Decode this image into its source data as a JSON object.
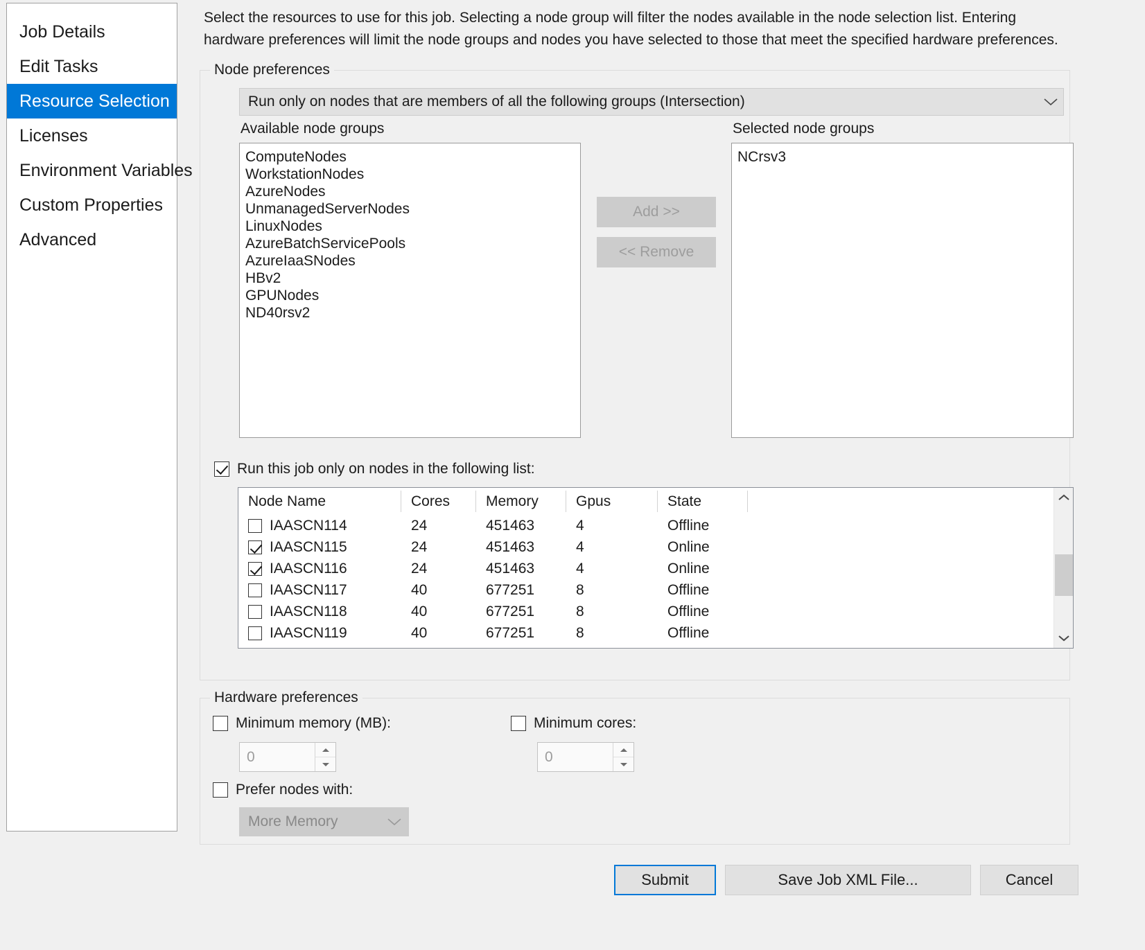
{
  "sidebar": {
    "items": [
      {
        "label": "Job Details",
        "active": false
      },
      {
        "label": "Edit Tasks",
        "active": false
      },
      {
        "label": "Resource Selection",
        "active": true
      },
      {
        "label": "Licenses",
        "active": false
      },
      {
        "label": "Environment Variables",
        "active": false
      },
      {
        "label": "Custom Properties",
        "active": false
      },
      {
        "label": "Advanced",
        "active": false
      }
    ]
  },
  "main": {
    "intro": "Select the resources to use for this job. Selecting a node group will filter the nodes available in the node selection list. Entering hardware preferences will limit the node groups and nodes you have selected to those that meet the specified hardware preferences."
  },
  "node_preferences": {
    "title": "Node preferences",
    "scope_combo": {
      "selected": "Run only on nodes that are members of all the following groups (Intersection)",
      "icon": "chevron-down-icon"
    },
    "available_label": "Available node groups",
    "selected_label": "Selected node groups",
    "available_groups": [
      "ComputeNodes",
      "WorkstationNodes",
      "AzureNodes",
      "UnmanagedServerNodes",
      "LinuxNodes",
      "AzureBatchServicePools",
      "AzureIaaSNodes",
      "HBv2",
      "GPUNodes",
      "ND40rsv2"
    ],
    "selected_groups": [
      "NCrsv3"
    ],
    "add_button": "Add >>",
    "remove_button": "<< Remove",
    "run_only_checkbox": {
      "label": "Run this job only on nodes in the following list:",
      "checked": true
    },
    "node_table": {
      "columns": [
        "Node Name",
        "Cores",
        "Memory",
        "Gpus",
        "State"
      ],
      "rows": [
        {
          "checked": false,
          "name": "IAASCN114",
          "cores": "24",
          "memory": "451463",
          "gpus": "4",
          "state": "Offline"
        },
        {
          "checked": true,
          "name": "IAASCN115",
          "cores": "24",
          "memory": "451463",
          "gpus": "4",
          "state": "Online"
        },
        {
          "checked": true,
          "name": "IAASCN116",
          "cores": "24",
          "memory": "451463",
          "gpus": "4",
          "state": "Online"
        },
        {
          "checked": false,
          "name": "IAASCN117",
          "cores": "40",
          "memory": "677251",
          "gpus": "8",
          "state": "Offline"
        },
        {
          "checked": false,
          "name": "IAASCN118",
          "cores": "40",
          "memory": "677251",
          "gpus": "8",
          "state": "Offline"
        },
        {
          "checked": false,
          "name": "IAASCN119",
          "cores": "40",
          "memory": "677251",
          "gpus": "8",
          "state": "Offline"
        }
      ],
      "scroll_up_icon": "chevron-up-icon",
      "scroll_down_icon": "chevron-down-icon"
    }
  },
  "hardware_preferences": {
    "title": "Hardware preferences",
    "min_memory": {
      "label": "Minimum memory (MB):",
      "checked": false,
      "value": "0"
    },
    "min_cores": {
      "label": "Minimum cores:",
      "checked": false,
      "value": "0"
    },
    "prefer_nodes": {
      "label": "Prefer nodes with:",
      "checked": false,
      "selected": "More Memory",
      "icon": "chevron-down-icon"
    }
  },
  "actions": {
    "submit": "Submit",
    "save_xml": "Save Job XML File...",
    "cancel": "Cancel"
  },
  "colors": {
    "accent": "#0078d7",
    "window": "#f0f0f0",
    "field": "#ffffff",
    "disabled_text": "#9d9d9d"
  }
}
